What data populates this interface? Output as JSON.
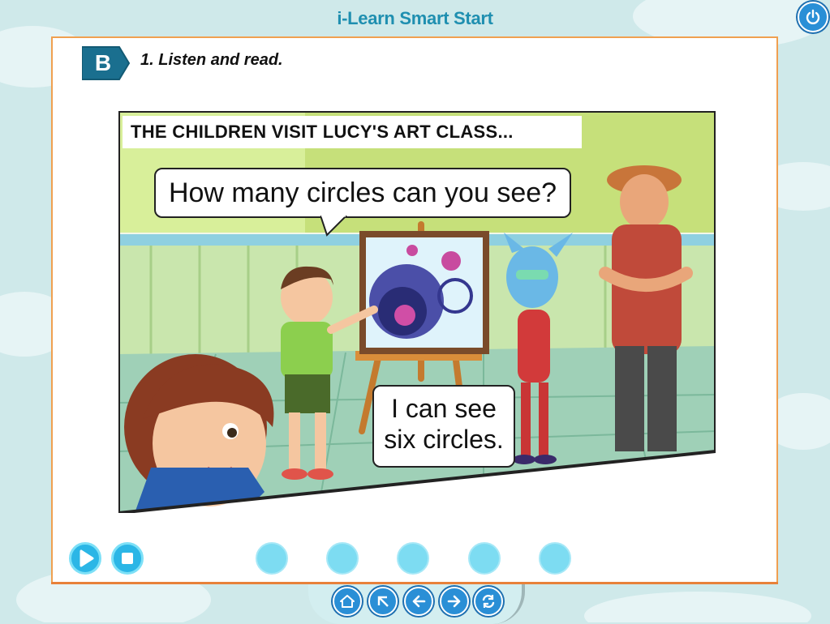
{
  "app": {
    "title": "i-Learn Smart Start"
  },
  "section": {
    "letter": "B",
    "instruction": "1. Listen and read."
  },
  "comic": {
    "caption": "THE CHILDREN VISIT LUCY'S ART CLASS...",
    "speech_1": "How many circles can you see?",
    "speech_2_line1": "I can see",
    "speech_2_line2": "six circles."
  },
  "controls": {
    "play_icon": "play-icon",
    "stop_icon": "stop-icon",
    "dot_count": 5
  },
  "nav": {
    "items": [
      "home-icon",
      "up-icon",
      "back-icon",
      "forward-icon",
      "refresh-icon"
    ]
  },
  "colors": {
    "title": "#1f8fb0",
    "panel_border": "#f0a050",
    "badge": "#1a6f8f",
    "button_blue": "#2bb6e6",
    "nav_blue": "#2a8fd6"
  }
}
